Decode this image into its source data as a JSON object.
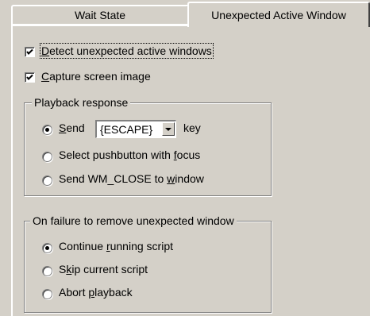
{
  "tabs": {
    "wait_state": "Wait State",
    "unexpected_active_window": "Unexpected Active Window"
  },
  "options": {
    "detect": {
      "pre": "",
      "key": "D",
      "post": "etect unexpected active windows",
      "checked": true
    },
    "capture": {
      "pre": "",
      "key": "C",
      "post": "apture screen image",
      "checked": true
    }
  },
  "playback_response": {
    "title": "Playback response",
    "send": {
      "pre": "",
      "key": "S",
      "post": "end",
      "selected": true
    },
    "send_value": "{ESCAPE}",
    "send_suffix": "key",
    "select_pushbutton": {
      "pre": "Select pushbutton with ",
      "key": "f",
      "post": "ocus",
      "selected": false
    },
    "send_wm_close": {
      "pre": "Send WM_CLOSE to ",
      "key": "w",
      "post": "indow",
      "selected": false
    }
  },
  "on_failure": {
    "title": "On failure to remove unexpected window",
    "continue": {
      "pre": "Continue ",
      "key": "r",
      "post": "unning script",
      "selected": true
    },
    "skip": {
      "pre": "S",
      "key": "k",
      "post": "ip current script",
      "selected": false
    },
    "abort": {
      "pre": "Abort ",
      "key": "p",
      "post": "layback",
      "selected": false
    }
  }
}
